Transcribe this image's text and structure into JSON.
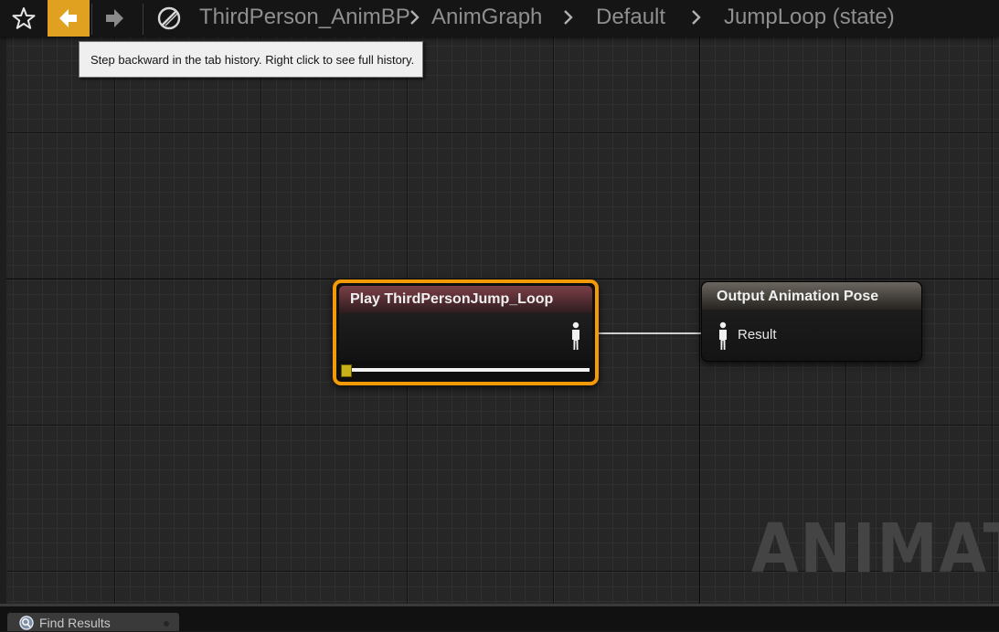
{
  "toolbar": {
    "icons": [
      "star-icon",
      "back-arrow-icon",
      "forward-arrow-icon",
      "blueprint-icon"
    ],
    "accent_color": "#e0a020"
  },
  "breadcrumb": {
    "items": [
      "ThirdPerson_AnimBP",
      "AnimGraph",
      "Default",
      "JumpLoop (state)"
    ]
  },
  "tooltip": {
    "text": "Step backward in the tab history. Right click to see full history."
  },
  "graph": {
    "watermark": "ANIMATI",
    "nodes": {
      "play": {
        "title": "Play ThirdPersonJump_Loop",
        "header_color": "#7a3f46",
        "selected_border_color": "#f39a08",
        "output_pin_icon": "pose-pin-icon"
      },
      "output": {
        "title": "Output Animation Pose",
        "pin_label": "Result",
        "input_pin_icon": "pose-pin-icon"
      }
    }
  },
  "bottom_tabs": [
    {
      "label": "Find Results",
      "icon": "find-results-icon"
    }
  ]
}
